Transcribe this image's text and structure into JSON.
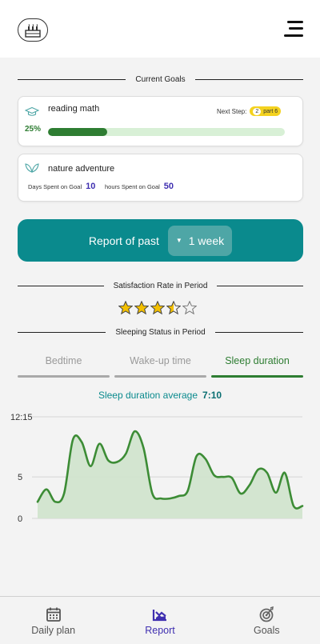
{
  "header": {
    "logo_icon": "birthday-cake-icon",
    "menu_icon": "hamburger-menu-icon"
  },
  "current_goals": {
    "title": "Current Goals",
    "goals": [
      {
        "icon": "graduation-cap-icon",
        "name": "reading math",
        "next_step_label": "Next Step:",
        "next_step_num": "2",
        "next_step_part": "part 6",
        "progress_label": "25%",
        "progress": 0.25
      },
      {
        "icon": "leaf-icon",
        "name": "nature adventure",
        "days_label": "Days Spent on Goal",
        "days_value": "10",
        "hours_label": "hours Spent on Goal",
        "hours_value": "50"
      }
    ]
  },
  "report": {
    "label": "Report of past",
    "period": "1 week"
  },
  "satisfaction": {
    "title": "Satisfaction Rate in Period",
    "rating": 3.5,
    "max": 5
  },
  "sleeping": {
    "title": "Sleeping Status in Period",
    "tabs": [
      {
        "label": "Bedtime",
        "active": false
      },
      {
        "label": "Wake-up time",
        "active": false
      },
      {
        "label": "Sleep duration",
        "active": true
      }
    ],
    "average_label": "Sleep duration average",
    "average_value": "7:10"
  },
  "chart_data": {
    "type": "area",
    "yticks": [
      "12:15",
      "5",
      "0"
    ],
    "ylim": [
      0,
      12.25
    ],
    "grid": true,
    "values": [
      2.0,
      3.5,
      2.0,
      3.0,
      9.5,
      9.2,
      6.3,
      9.0,
      7.0,
      6.8,
      7.8,
      10.5,
      8.5,
      3.0,
      2.4,
      2.4,
      2.7,
      3.3,
      7.5,
      7.2,
      5.2,
      5.0,
      4.9,
      3.0,
      4.0,
      5.9,
      5.5,
      3.1,
      5.5,
      1.5,
      1.5
    ],
    "colors": {
      "line": "#3c8c35",
      "fill": "#cfe3cc",
      "grid": "#d4d4d4"
    }
  },
  "nav": [
    {
      "icon": "calendar-icon",
      "label": "Daily plan",
      "active": false
    },
    {
      "icon": "report-chart-icon",
      "label": "Report",
      "active": true
    },
    {
      "icon": "target-icon",
      "label": "Goals",
      "active": false
    }
  ]
}
